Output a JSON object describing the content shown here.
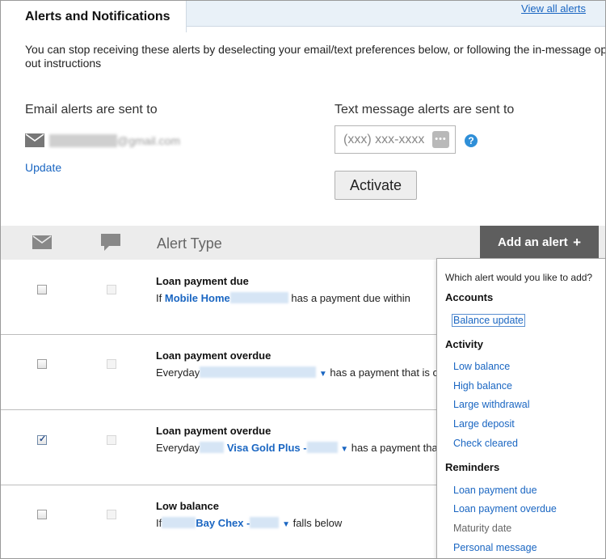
{
  "header": {
    "tab_title": "Alerts and Notifications",
    "view_all_link": "View all alerts"
  },
  "intro": {
    "line1": "You can stop receiving these alerts by deselecting your email/text preferences below, or following the in-message opt-",
    "line2": "out instructions"
  },
  "email": {
    "heading": "Email alerts are sent to",
    "address": "@gmail.com",
    "update_link": "Update"
  },
  "text_message": {
    "heading": "Text message alerts are sent to",
    "placeholder": "(xxx) xxx-xxxx",
    "activate_button": "Activate",
    "help_glyph": "?"
  },
  "table": {
    "header_label": "Alert Type",
    "add_button": "Add an alert",
    "add_button_icon": "+",
    "rows": [
      {
        "title": "Loan payment due",
        "pre": "If",
        "account": "Mobile Home",
        "post": "has a payment due within",
        "email_checked": false
      },
      {
        "title": "Loan payment overdue",
        "pre": "Everyday",
        "account": "",
        "post": "has a payment that is ov",
        "email_checked": false
      },
      {
        "title": "Loan payment overdue",
        "pre": "Everyday",
        "account": "Visa Gold Plus -",
        "post": "has a payment that",
        "email_checked": true
      },
      {
        "title": "Low balance",
        "pre": "If",
        "account": "Bay Chex -",
        "post": "falls below",
        "email_checked": false
      }
    ]
  },
  "dropdown": {
    "question": "Which alert would you like to add?",
    "sections": [
      {
        "label": "Accounts",
        "items": [
          "Balance update"
        ]
      },
      {
        "label": "Activity",
        "items": [
          "Low balance",
          "High balance",
          "Large withdrawal",
          "Large deposit",
          "Check cleared"
        ]
      },
      {
        "label": "Reminders",
        "items": [
          "Loan payment due",
          "Loan payment overdue",
          "Maturity date",
          "Personal message"
        ]
      }
    ]
  },
  "colors": {
    "link": "#1a66c2",
    "add_button_bg": "#5e5e5e",
    "table_header_bg": "#ececec"
  },
  "icons": {
    "email": "envelope-icon",
    "text": "chat-bubble-icon",
    "phone_picker": "dots-icon",
    "help": "help-icon"
  }
}
